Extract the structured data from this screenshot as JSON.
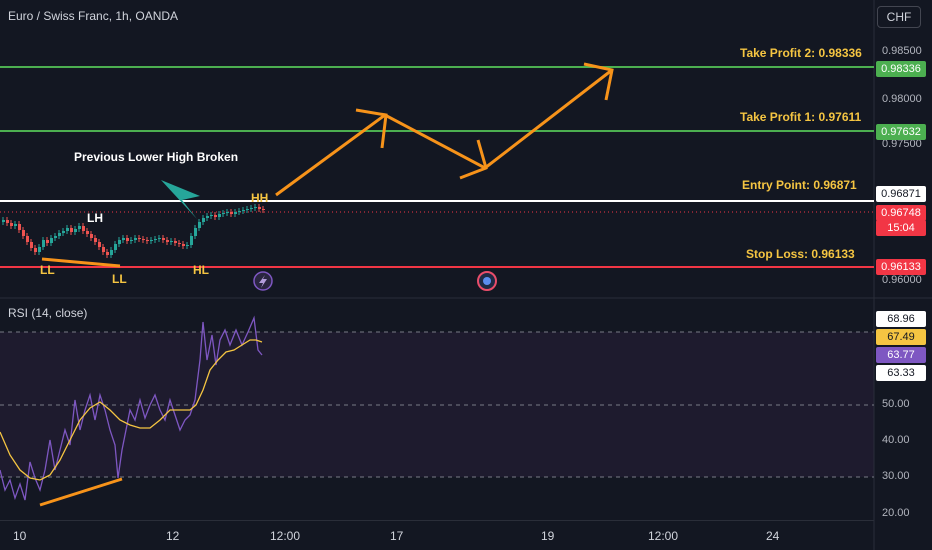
{
  "header": {
    "title": "Euro / Swiss Franc, 1h, OANDA",
    "currency_button": "CHF"
  },
  "levels": {
    "tp2": {
      "label": "Take Profit 2: 0.98336",
      "tag": "0.98336",
      "color": "#4caf50"
    },
    "tp1": {
      "label": "Take Profit 1: 0.97611",
      "tag": "0.97632",
      "color": "#4caf50"
    },
    "entry": {
      "label": "Entry Point: 0.96871",
      "tag": "0.96871",
      "color": "#ffffff"
    },
    "stop": {
      "label": "Stop Loss: 0.96133",
      "tag": "0.96133",
      "color": "#f23645"
    }
  },
  "current_price": {
    "value": "0.96748",
    "countdown": "15:04",
    "color": "#f23645"
  },
  "price_axis": [
    "0.98500",
    "0.98000",
    "0.97500",
    "0.96000"
  ],
  "annotations": {
    "prev_lower_high": "Previous Lower High Broken",
    "markers": [
      "LH",
      "LL",
      "LL",
      "HL",
      "HH"
    ]
  },
  "rsi": {
    "title": "RSI (14, close)",
    "tags": [
      "68.96",
      "67.49",
      "63.77",
      "63.33"
    ],
    "axis": [
      "50.00",
      "40.00",
      "30.00",
      "20.00"
    ]
  },
  "time_axis": [
    "10",
    "12",
    "12:00",
    "17",
    "19",
    "12:00",
    "24"
  ],
  "colors": {
    "background": "#131722",
    "arrow": "#f7931a",
    "rsi_line": "#7e57c2",
    "rsi_ma": "#f5c542"
  }
}
